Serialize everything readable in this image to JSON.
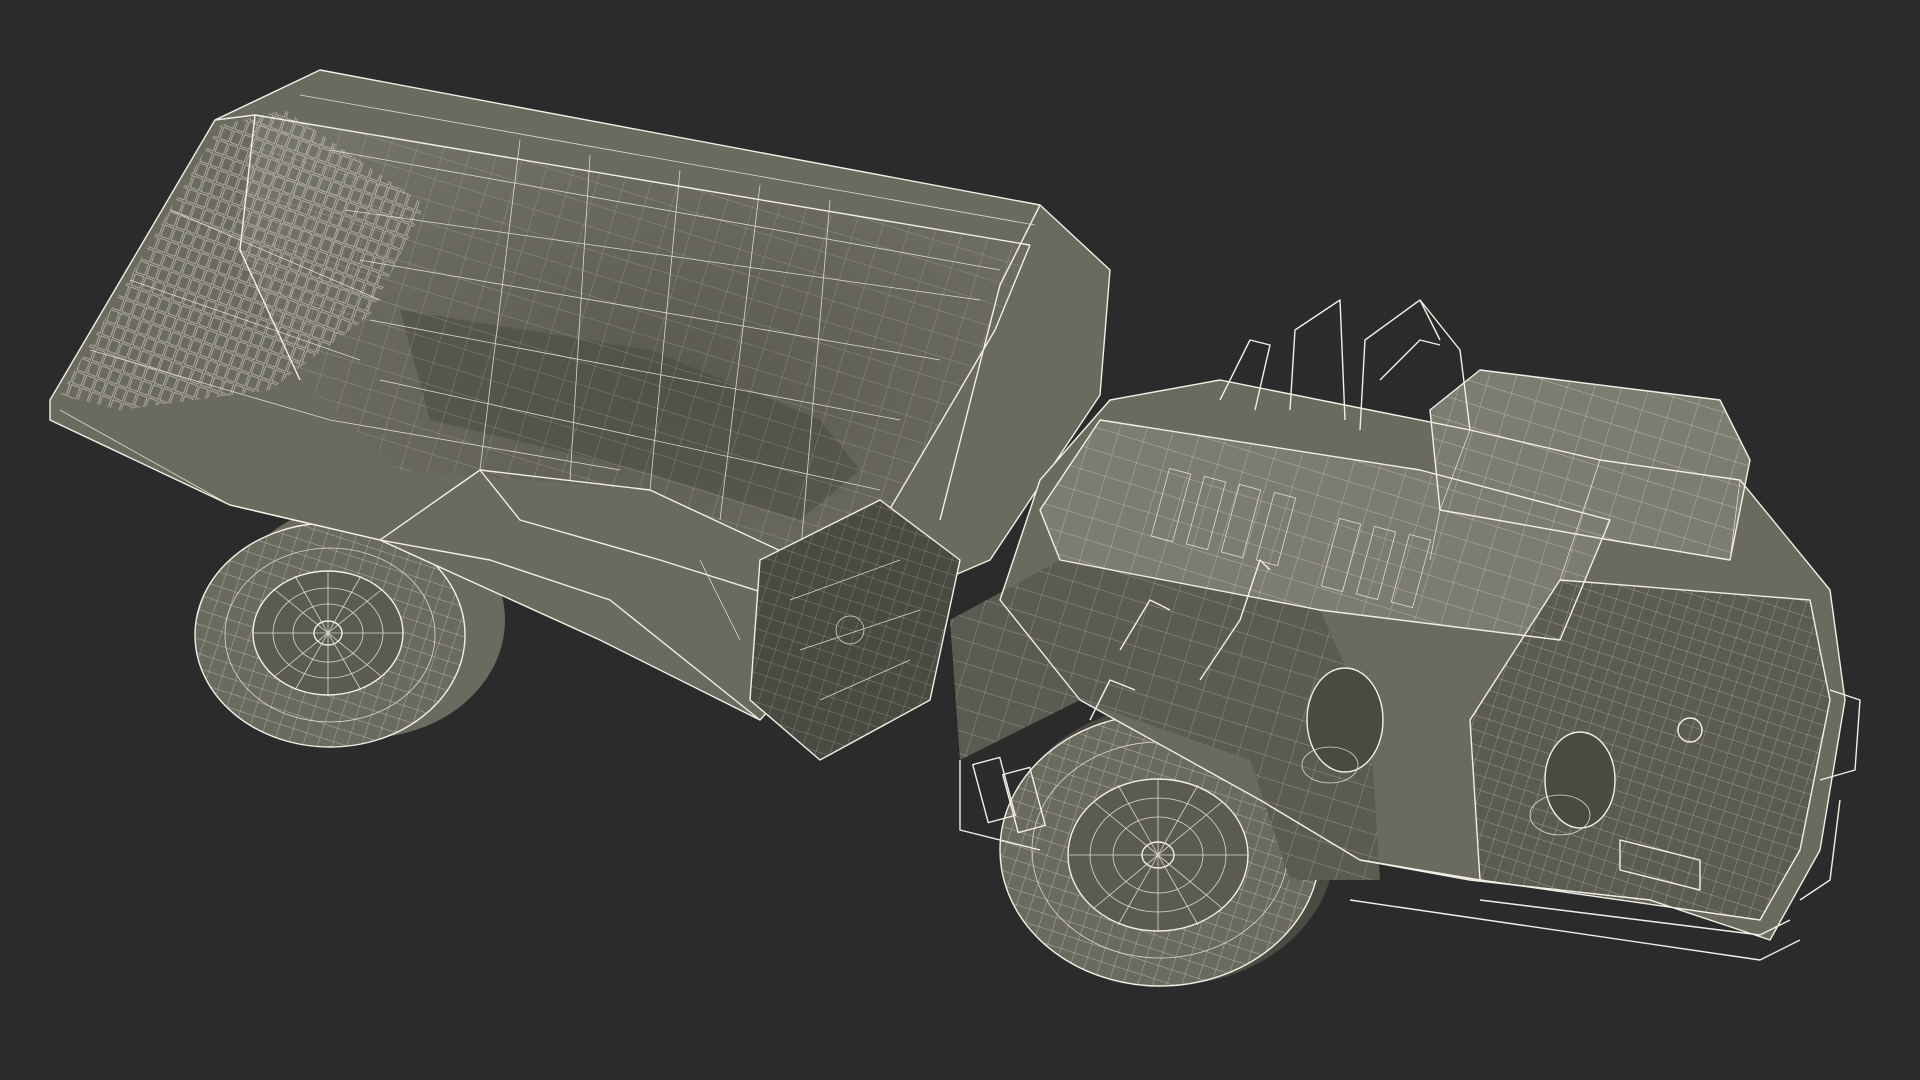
{
  "scene": {
    "background": "#2b2b2b",
    "wire_color": "#f2f0e6",
    "model_color": "#6b6a5f"
  }
}
